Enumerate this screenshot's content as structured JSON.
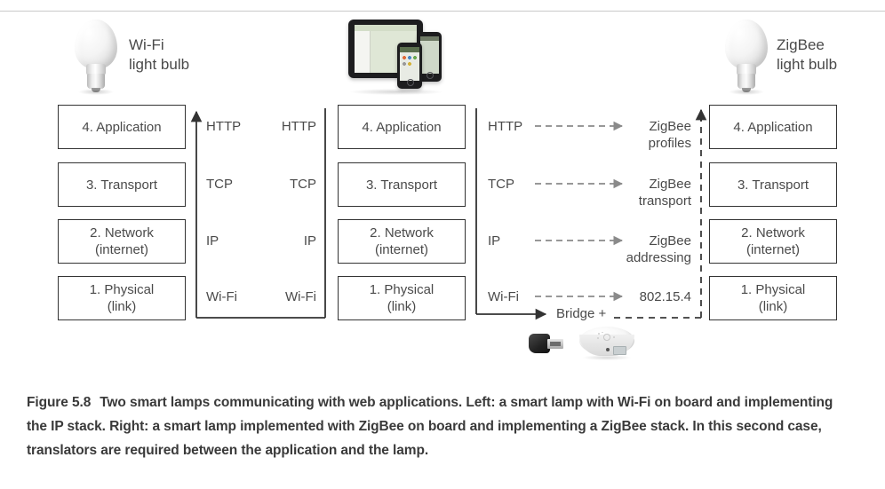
{
  "figure": {
    "number": "Figure 5.8",
    "caption": "Two smart lamps communicating with web applications. Left: a smart lamp with Wi-Fi on board and implementing the IP stack. Right: a smart lamp implemented with ZigBee on board and implementing a ZigBee stack. In this second case, translators are required between the application and the lamp."
  },
  "devices": {
    "left_bulb": {
      "label": "Wi-Fi\nlight bulb",
      "icon": "light-bulb-icon"
    },
    "center_screens": {
      "icon": "tablet-and-phones-icon"
    },
    "right_bulb": {
      "label": "ZigBee\nlight bulb",
      "icon": "light-bulb-icon"
    },
    "bridge": {
      "label": "Bridge +",
      "dongle_icon": "usb-dongle-icon",
      "hub_icon": "round-hub-icon"
    }
  },
  "stacks": {
    "left_lamp": {
      "layers": [
        "4. Application",
        "3. Transport",
        "2. Network\n(internet)",
        "1. Physical\n(link)"
      ]
    },
    "center_app": {
      "layers": [
        "4. Application",
        "3. Transport",
        "2. Network\n(internet)",
        "1. Physical\n(link)"
      ]
    },
    "right_lamp": {
      "layers": [
        "4. Application",
        "3. Transport",
        "2. Network\n(internet)",
        "1. Physical\n(link)"
      ]
    }
  },
  "protocols": {
    "left_inner": [
      "HTTP",
      "TCP",
      "IP",
      "Wi-Fi"
    ],
    "left_outer": [
      "HTTP",
      "TCP",
      "IP",
      "Wi-Fi"
    ],
    "center": [
      "HTTP",
      "TCP",
      "IP",
      "Wi-Fi"
    ],
    "zigbee": [
      "ZigBee\nprofiles",
      "ZigBee\ntransport",
      "ZigBee\naddressing",
      "802.15.4"
    ]
  },
  "colors": {
    "box_border": "#333333",
    "text": "#4a4a4a",
    "caption_text": "#3a3a3a",
    "solid_connector": "#333333",
    "dashed_connector": "#8a8a8a",
    "background": "#ffffff"
  }
}
